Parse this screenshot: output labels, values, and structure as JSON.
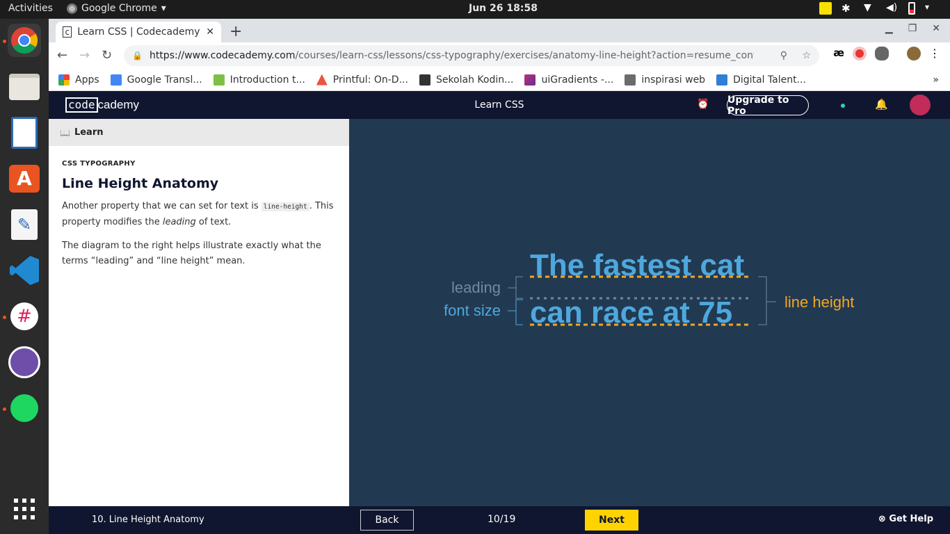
{
  "topbar": {
    "activities": "Activities",
    "app_name": "Google Chrome",
    "clock": "Jun 26  18:58"
  },
  "dock": {
    "items": [
      {
        "name": "chrome",
        "color": "#4285f4",
        "running": true
      },
      {
        "name": "files",
        "color": "#d7d3ca",
        "running": false
      },
      {
        "name": "libreoffice-impress",
        "color": "#2a6bb5",
        "running": false
      },
      {
        "name": "software-center",
        "color": "#e95420",
        "running": false
      },
      {
        "name": "text-editor",
        "color": "#f2f2f2",
        "running": false
      },
      {
        "name": "vscode",
        "color": "#1f8ad2",
        "running": false
      },
      {
        "name": "slack",
        "color": "#ffffff",
        "running": true
      },
      {
        "name": "github-desktop",
        "color": "#6e4ea8",
        "running": false
      },
      {
        "name": "spotify",
        "color": "#1ed760",
        "running": true
      }
    ]
  },
  "browser": {
    "tab_title": "Learn CSS | Codecademy",
    "url_host": "https://www.codecademy.com",
    "url_path": "/courses/learn-css/lessons/css-typography/exercises/anatomy-line-height?action=resume_content_item",
    "bookmarks": [
      {
        "label": "Apps",
        "color": "#ea4335"
      },
      {
        "label": "Google Transl...",
        "color": "#4285f4"
      },
      {
        "label": "Introduction t...",
        "color": "#7bc043"
      },
      {
        "label": "Printful: On-D...",
        "color": "#e8553e"
      },
      {
        "label": "Sekolah Kodin...",
        "color": "#333333"
      },
      {
        "label": "uiGradients -...",
        "color": "#b5347a"
      },
      {
        "label": "inspirasi web",
        "color": "#6b6b6b"
      },
      {
        "label": "Digital Talent...",
        "color": "#2f7fd6"
      }
    ]
  },
  "codecademy": {
    "logo_code": "code",
    "logo_rest": "cademy",
    "header_title": "Learn CSS",
    "upgrade": "Upgrade to Pro",
    "learn_tab": "Learn",
    "course": "CSS TYPOGRAPHY",
    "lesson_title": "Line Height Anatomy",
    "p1_a": "Another property that we can set for text is ",
    "p1_code": "line-height",
    "p1_b": ". This property modifies the ",
    "p1_em": "leading",
    "p1_c": " of text.",
    "p2": "The diagram to the right helps illustrate exactly what the terms “leading” and “line height” mean."
  },
  "diagram": {
    "line1": "The fastest cat",
    "line2": "can race at 75",
    "label_leading": "leading",
    "label_font_size": "font size",
    "label_line_height": "line height",
    "colors": {
      "text": "#4ea8de",
      "leading": "#6f8aa3",
      "accent": "#f5a623",
      "bg": "#213a52"
    }
  },
  "footer": {
    "lesson": "10. Line Height Anatomy",
    "back": "Back",
    "progress": "10/19",
    "next": "Next",
    "help": "Get Help"
  }
}
